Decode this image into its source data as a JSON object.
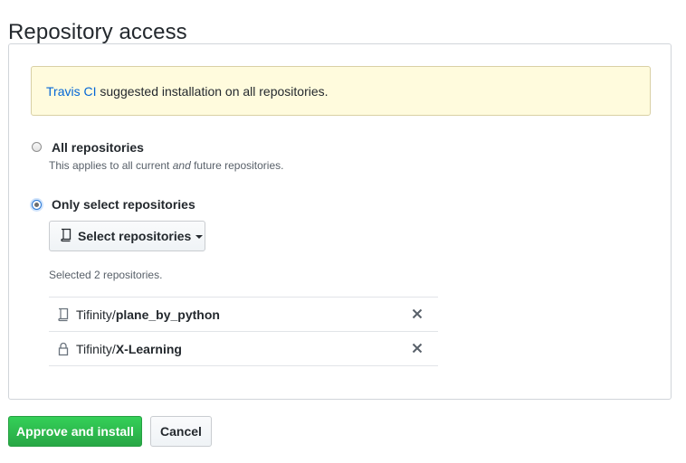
{
  "page": {
    "title": "Repository access"
  },
  "flash": {
    "link_text": "Travis CI",
    "message": " suggested installation on all repositories."
  },
  "options": {
    "all": {
      "label": "All repositories",
      "note_prefix": "This applies to all current ",
      "note_em": "and",
      "note_suffix": " future repositories.",
      "selected": false
    },
    "select": {
      "label": "Only select repositories",
      "selected": true
    }
  },
  "select_button": {
    "label": "Select repositories",
    "icon": "repo-icon"
  },
  "selected_count_text": "Selected 2 repositories.",
  "repositories": [
    {
      "owner": "Tifinity/",
      "name": "plane_by_python",
      "icon": "repo-icon"
    },
    {
      "owner": "Tifinity/",
      "name": "X-Learning",
      "icon": "lock-icon"
    }
  ],
  "actions": {
    "approve_label": "Approve and install",
    "cancel_label": "Cancel"
  },
  "colors": {
    "primary_green": "#2ea44f",
    "link_blue": "#0366d6",
    "flash_bg": "#fffbdd"
  }
}
